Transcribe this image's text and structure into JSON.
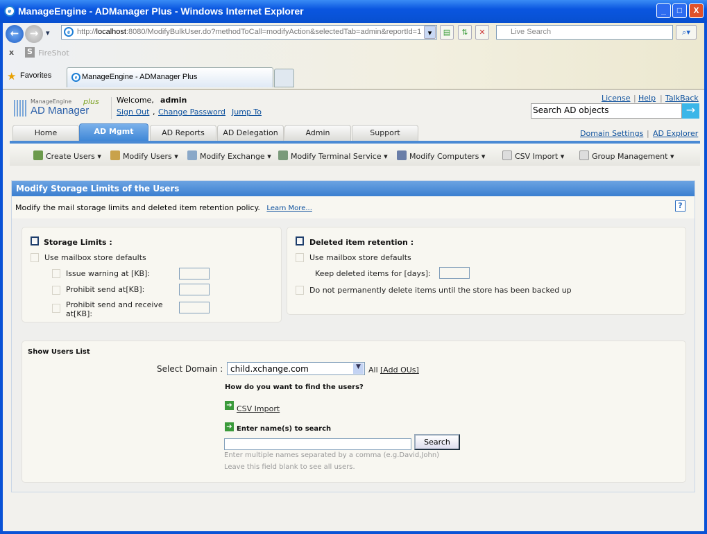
{
  "window": {
    "title": "ManageEngine - ADManager Plus - Windows Internet Explorer",
    "min": "_",
    "max": "□",
    "close": "X"
  },
  "browser": {
    "url_prefix": "http://",
    "url_host": "localhost",
    "url_rest": ":8080/ModifyBulkUser.do?methodToCall=modifyAction&selectedTab=admin&reportId=1",
    "search_placeholder": "Live Search",
    "toolbar_item": "FireShot",
    "favorites": "Favorites",
    "tab_title": "ManageEngine - ADManager Plus"
  },
  "header": {
    "logo_top": "ManageEngine",
    "logo_main": "AD Manager",
    "logo_plus": "plus",
    "welcome": "Welcome,",
    "user": "admin",
    "sign_out": "Sign Out",
    "change_password": "Change Password",
    "jump_to": "Jump To",
    "license": "License",
    "help": "Help",
    "talkback": "TalkBack",
    "search_value": "Search AD objects",
    "domain_settings": "Domain Settings",
    "ad_explorer": "AD Explorer"
  },
  "tabs": [
    "Home",
    "AD Mgmt",
    "AD Reports",
    "AD Delegation",
    "Admin",
    "Support"
  ],
  "menu": [
    "Create Users",
    "Modify Users",
    "Modify Exchange",
    "Modify Terminal Service",
    "Modify Computers",
    "CSV Import",
    "Group Management"
  ],
  "panel": {
    "title": "Modify Storage Limits of the Users",
    "description": "Modify the mail storage limits and deleted item retention policy.",
    "learn_more": "Learn More...",
    "help": "?"
  },
  "storage": {
    "title": "Storage Limits :",
    "use_defaults": "Use mailbox store defaults",
    "issue_warning": "Issue warning at [KB]:",
    "prohibit_send": "Prohibit send at[KB]:",
    "prohibit_send_receive_1": "Prohibit send and receive",
    "prohibit_send_receive_2": "at[KB]:"
  },
  "retention": {
    "title": "Deleted item retention :",
    "use_defaults": "Use mailbox store defaults",
    "keep_days": "Keep deleted items for [days]:",
    "no_delete": "Do not permanently delete items until the store has been backed up"
  },
  "users": {
    "title": "Show Users List",
    "select_domain": "Select Domain :",
    "domain": "child.xchange.com",
    "all": "All",
    "add_ous": "[Add OUs]",
    "question": "How do you want to find the users?",
    "csv_import": "CSV Import",
    "enter_names": "Enter name(s) to search",
    "search_button": "Search",
    "hint1": "Enter multiple names separated by a comma (e.g.David,John)",
    "hint2": "Leave this field blank to see all users."
  }
}
